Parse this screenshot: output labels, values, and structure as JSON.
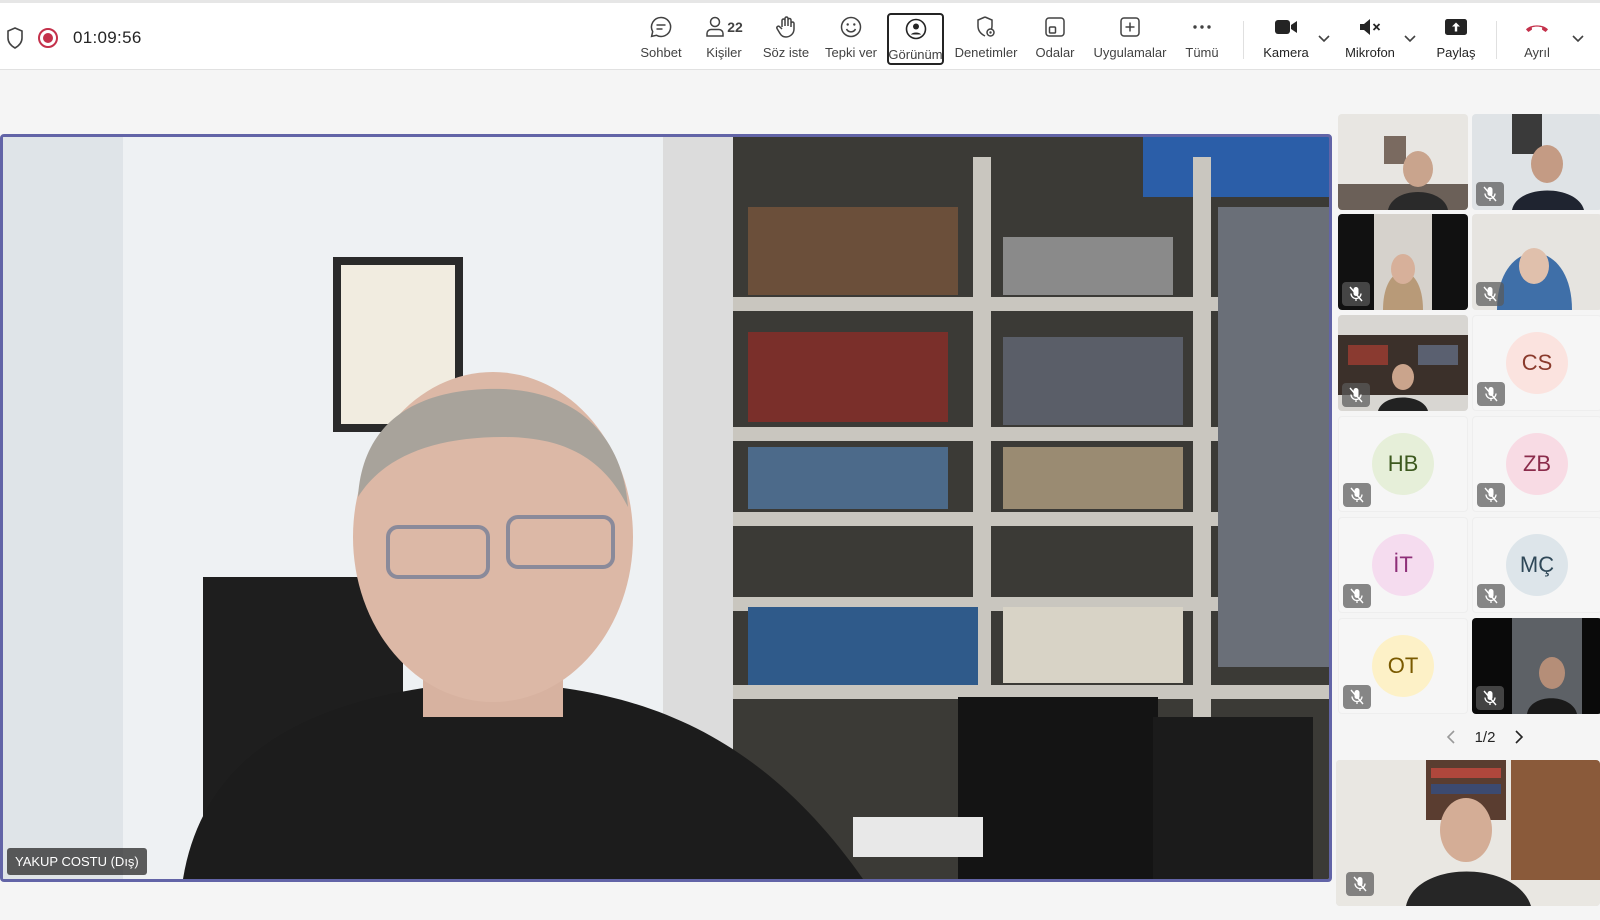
{
  "meeting": {
    "timer": "01:09:56",
    "participant_count": "22"
  },
  "toolbar": {
    "chat": "Sohbet",
    "people": "Kişiler",
    "raise_hand": "Söz iste",
    "react": "Tepki ver",
    "view": "Görünüm",
    "controls": "Denetimler",
    "rooms": "Odalar",
    "apps": "Uygulamalar",
    "more": "Tümü",
    "camera": "Kamera",
    "mic": "Mikrofon",
    "share": "Paylaş",
    "leave": "Ayrıl"
  },
  "stage": {
    "speaker_name": "YAKUP COSTU (Dış)"
  },
  "gallery": {
    "avatars": [
      {
        "initials": "CS",
        "bg": "#fbe3df",
        "fg": "#8a3a2c"
      },
      {
        "initials": "HB",
        "bg": "#e6efd9",
        "fg": "#3d5a1f"
      },
      {
        "initials": "ZB",
        "bg": "#f8dbe4",
        "fg": "#8b2c4b"
      },
      {
        "initials": "İT",
        "bg": "#f5dcef",
        "fg": "#8e2f78"
      },
      {
        "initials": "MÇ",
        "bg": "#dde5ea",
        "fg": "#2f4858"
      },
      {
        "initials": "OT",
        "bg": "#fdf1c7",
        "fg": "#7a5a00"
      }
    ],
    "page": "1/2"
  },
  "colors": {
    "accent": "#6264a7",
    "record": "#c4314b",
    "leave": "#c4314b"
  }
}
